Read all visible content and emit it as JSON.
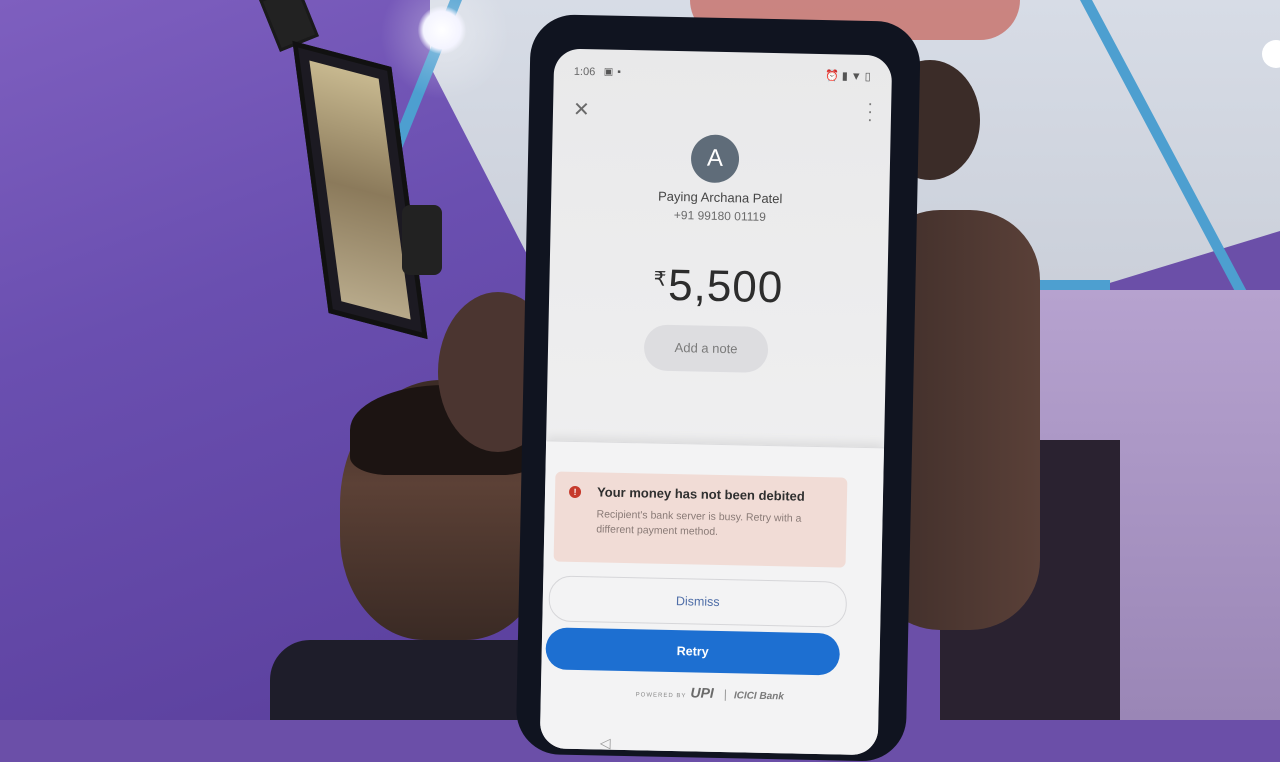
{
  "statusbar": {
    "time": "1:06",
    "left_icons": [
      "image-icon",
      "message-icon"
    ],
    "right_icons": [
      "alarm-icon",
      "signal-icon",
      "wifi-icon",
      "battery-icon"
    ]
  },
  "header": {
    "close_icon": "close-icon",
    "menu_icon": "more-vert-icon"
  },
  "payee": {
    "avatar_letter": "A",
    "paying_label": "Paying Archana Patel",
    "phone": "+91 99180 01119"
  },
  "payment": {
    "currency_symbol": "₹",
    "amount": "5,500",
    "note_placeholder": "Add a note"
  },
  "error": {
    "icon": "alert-icon",
    "title": "Your money has not been debited",
    "message": "Recipient's bank server is busy. Retry with a different payment method."
  },
  "actions": {
    "dismiss_label": "Dismiss",
    "retry_label": "Retry"
  },
  "footer": {
    "powered_by": "POWERED BY",
    "upi": "UPI",
    "bank": "ICICI Bank"
  },
  "colors": {
    "retry_button": "#1d6fd1",
    "error_background": "#f1dcd6",
    "error_icon": "#c63a2c",
    "avatar": "#5f6c79"
  }
}
